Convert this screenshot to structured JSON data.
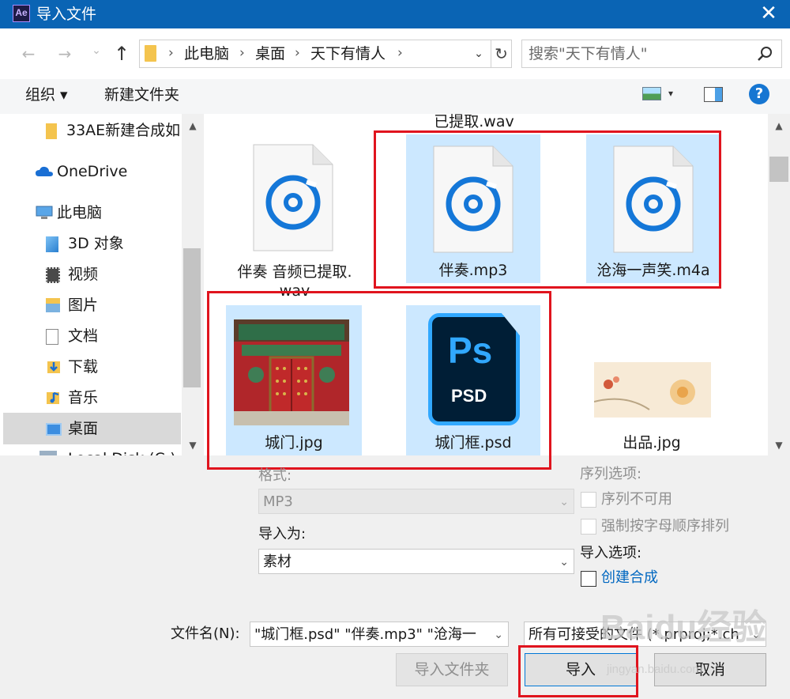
{
  "window": {
    "app_logo": "Ae",
    "title": "导入文件",
    "close_glyph": "✕"
  },
  "nav": {
    "back_glyph": "←",
    "forward_glyph": "→",
    "history_glyph": "⌄",
    "up_glyph": "↑",
    "breadcrumbs": [
      "此电脑",
      "桌面",
      "天下有情人"
    ],
    "separator": "›",
    "dropdown_glyph": "⌄",
    "refresh_glyph": "↻",
    "search_placeholder": "搜索\"天下有情人\""
  },
  "toolbar": {
    "organize_label": "组织 ▾",
    "new_folder_label": "新建文件夹",
    "view_dd": "▾",
    "help_label": "?"
  },
  "sidebar": {
    "items": [
      {
        "label": "33AE新建合成如",
        "icon": "folder-icon"
      },
      {
        "label": "OneDrive",
        "icon": "cloud-icon"
      },
      {
        "label": "此电脑",
        "icon": "computer-icon"
      },
      {
        "label": "3D 对象",
        "icon": "3d-objects-icon"
      },
      {
        "label": "视频",
        "icon": "video-icon"
      },
      {
        "label": "图片",
        "icon": "pictures-icon"
      },
      {
        "label": "文档",
        "icon": "documents-icon"
      },
      {
        "label": "下载",
        "icon": "downloads-icon"
      },
      {
        "label": "音乐",
        "icon": "music-icon"
      },
      {
        "label": "桌面",
        "icon": "desktop-icon"
      },
      {
        "label": "Local Disk (C:)",
        "icon": "disk-icon"
      }
    ],
    "selected": "桌面"
  },
  "files": {
    "partial_top_label": "已提取.wav",
    "items": [
      {
        "name": "伴奏 音频已提取.wav",
        "line1": "伴奏 音频已提取.",
        "line2": "wav",
        "type": "audio",
        "selected": false
      },
      {
        "name": "伴奏.mp3",
        "type": "audio",
        "selected": true
      },
      {
        "name": "沧海一声笑.m4a",
        "type": "audio",
        "selected": true
      },
      {
        "name": "城门.jpg",
        "type": "image",
        "selected": true
      },
      {
        "name": "城门框.psd",
        "type": "photoshop",
        "selected": true,
        "ps_text": "Ps",
        "ps_sub": "PSD"
      },
      {
        "name": "出品.jpg",
        "type": "image",
        "selected": false
      }
    ]
  },
  "options": {
    "format_label": "格式:",
    "format_value": "MP3",
    "import_as_label": "导入为:",
    "import_as_value": "素材",
    "sequence_label": "序列选项:",
    "seq_unavailable": "序列不可用",
    "force_alpha": "强制按字母顺序排列",
    "import_options_label": "导入选项:",
    "create_comp": "创建合成"
  },
  "bottom": {
    "filename_label": "文件名(N):",
    "filename_value": "\"城门框.psd\" \"伴奏.mp3\" \"沧海一",
    "filetype_value": "所有可接受的文件 (*.prproj;*.ch",
    "import_folder_label": "导入文件夹",
    "import_label": "导入",
    "cancel_label": "取消"
  },
  "watermark": {
    "main": "Baidu经验",
    "sub": "jingyan.baidu.com"
  },
  "colors": {
    "titlebar": "#0a64b4",
    "selection": "#cce8ff",
    "highlight_box": "#e0141e",
    "audio_icon": "#1477d8",
    "link": "#0067c0"
  }
}
